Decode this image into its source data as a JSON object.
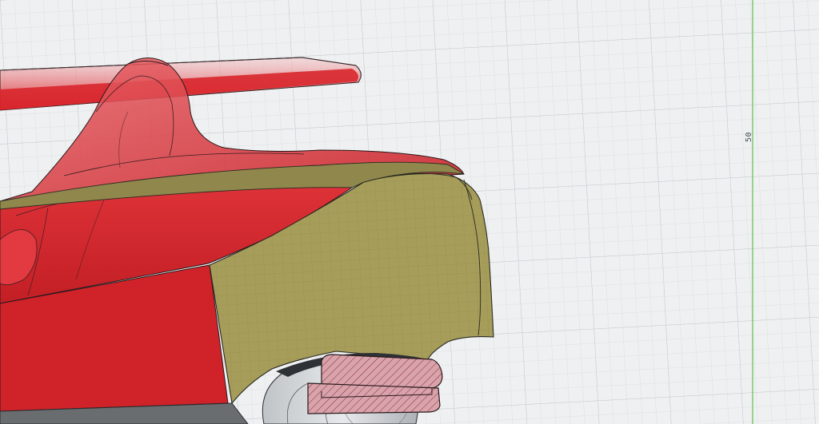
{
  "viewport": {
    "axis_value_label": "50",
    "colors": {
      "background": "#eef0f1",
      "grid_minor": "#d6d9dc",
      "grid_major": "#c3c7cb",
      "axis_green": "#5dc24a",
      "body_red": "#d7262b",
      "body_red_dark": "#b51a20",
      "section_khaki": "#9a9050",
      "section_khaki_light": "#b5ad6b",
      "hatch_pink": "#d7a6ad",
      "outline": "#1d1f22"
    }
  }
}
